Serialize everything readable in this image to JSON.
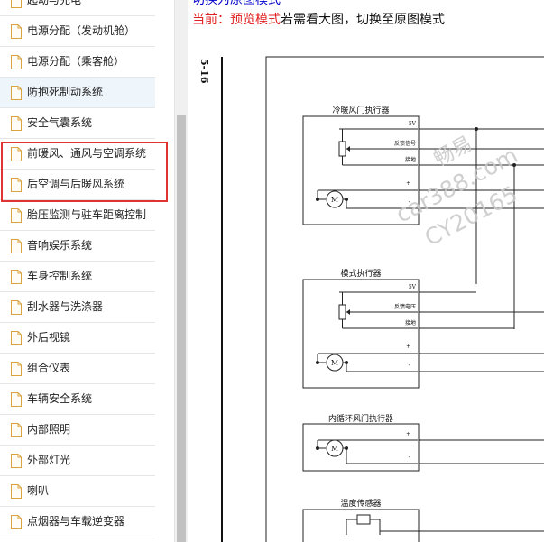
{
  "sidebar": {
    "items": [
      {
        "label": "起动与充电"
      },
      {
        "label": "电源分配（发动机舱）"
      },
      {
        "label": "电源分配（乘客舱）"
      },
      {
        "label": "防抱死制动系统"
      },
      {
        "label": "安全气囊系统"
      },
      {
        "label": "前暖风、通风与空调系统"
      },
      {
        "label": "后空调与后暖风系统"
      },
      {
        "label": "胎压监测与驻车距离控制"
      },
      {
        "label": "音响娱乐系统"
      },
      {
        "label": "车身控制系统"
      },
      {
        "label": "刮水器与洗涤器"
      },
      {
        "label": "外后视镜"
      },
      {
        "label": "组合仪表"
      },
      {
        "label": "车辆安全系统"
      },
      {
        "label": "内部照明"
      },
      {
        "label": "外部灯光"
      },
      {
        "label": "喇叭"
      },
      {
        "label": "点烟器与车载逆变器"
      }
    ],
    "active_index": 3,
    "highlighted_indices": [
      5,
      6
    ]
  },
  "content": {
    "switch_link": "切换为原图模式",
    "current_mode_prefix": "当前：预览模式",
    "current_mode_hint": "若需看大图，切换至原图模式"
  },
  "diagram": {
    "page_number": "5-16",
    "blocks": [
      {
        "title": "冷暖风门执行器",
        "pins": [
          "5V",
          "反馈信号",
          "接地",
          "+",
          "-"
        ]
      },
      {
        "title": "模式执行器",
        "pins": [
          "5V",
          "反馈电压",
          "接地",
          "+",
          "-"
        ]
      },
      {
        "title": "内循环风门执行器",
        "pins": [
          "+",
          "-"
        ]
      },
      {
        "title": "温度传感器",
        "pins": []
      }
    ],
    "motor_label": "M"
  },
  "watermark": {
    "brand": "畅易",
    "site": "car388.com",
    "code": "CY20165"
  },
  "colors": {
    "highlight_border": "#e03434",
    "current_mode": "#e02020",
    "link": "#0000cc",
    "active_item_bg": "#eef5fb"
  }
}
